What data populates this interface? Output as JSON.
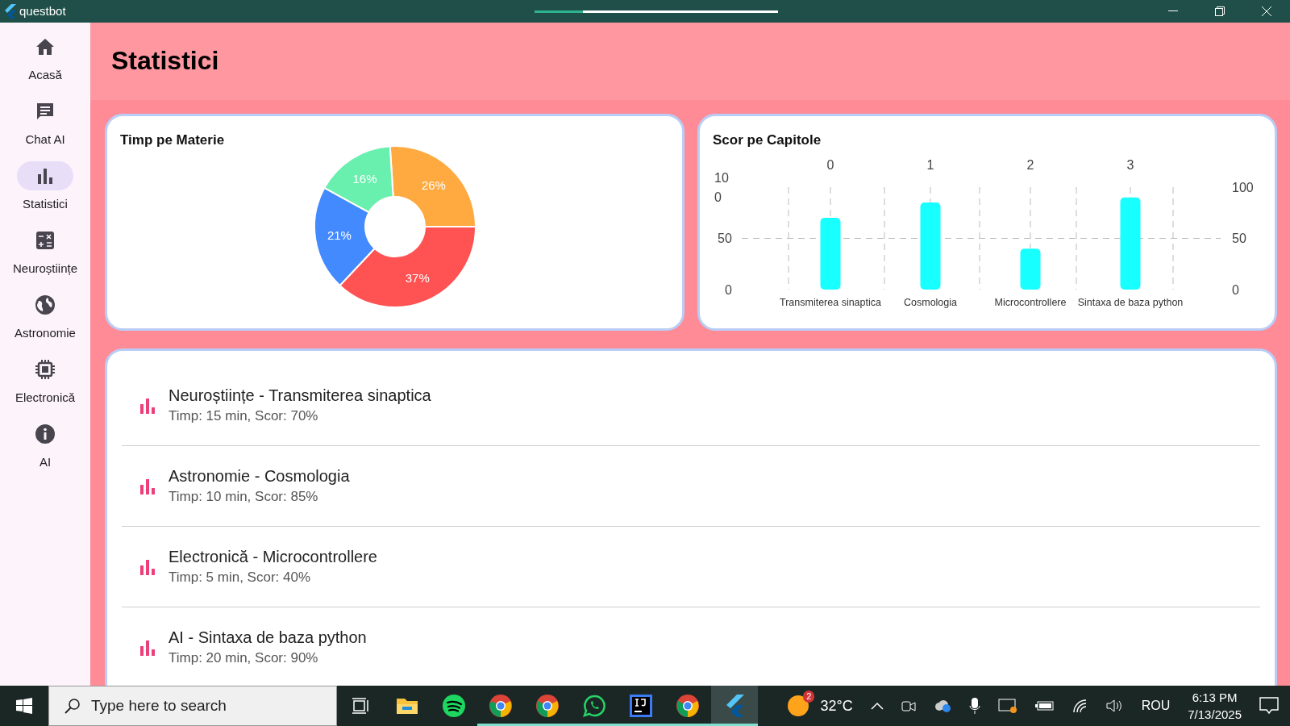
{
  "window": {
    "title": "questbot"
  },
  "sidebar": {
    "items": [
      {
        "label": "Acasă",
        "selected": false
      },
      {
        "label": "Chat AI",
        "selected": false
      },
      {
        "label": "Statistici",
        "selected": true
      },
      {
        "label": "Neuroștiințe",
        "selected": false
      },
      {
        "label": "Astronomie",
        "selected": false
      },
      {
        "label": "Electronică",
        "selected": false
      },
      {
        "label": "AI",
        "selected": false
      }
    ]
  },
  "page": {
    "title": "Statistici"
  },
  "time_chart": {
    "title": "Timp pe Materie",
    "chart_data": {
      "type": "donut",
      "values": [
        26,
        37,
        21,
        16
      ],
      "value_labels": [
        "26%",
        "37%",
        "21%",
        "16%"
      ],
      "data_labels": true
    }
  },
  "score_chart": {
    "title": "Scor pe Capitole",
    "top_axis_labels": [
      "0",
      "1",
      "2",
      "3"
    ],
    "right_axis_labels": [
      "100",
      "50",
      "0"
    ],
    "chart_data": {
      "type": "bar",
      "categories": [
        "Transmiterea sinaptica",
        "Cosmologia",
        "Microcontrollere",
        "Sintaxa de baza python"
      ],
      "values": [
        70,
        85,
        40,
        90
      ],
      "ylim": [
        0,
        100
      ],
      "yticks": [
        0,
        50,
        100
      ]
    }
  },
  "sessions": [
    {
      "title": "Neuroștiințe - Transmiterea sinaptica",
      "detail": "Timp: 15 min, Scor: 70%"
    },
    {
      "title": "Astronomie - Cosmologia",
      "detail": "Timp: 10 min, Scor: 85%"
    },
    {
      "title": "Electronică - Microcontrollere",
      "detail": "Timp: 5 min, Scor: 40%"
    },
    {
      "title": "AI - Sintaxa de baza python",
      "detail": "Timp: 20 min, Scor: 90%"
    }
  ],
  "taskbar": {
    "search": {
      "placeholder": "Type here to search"
    },
    "apps": [
      {
        "kind": "folder",
        "running": false,
        "active": false
      },
      {
        "kind": "spotify",
        "running": false,
        "active": false
      },
      {
        "kind": "chrome",
        "running": true,
        "active": false
      },
      {
        "kind": "chrome",
        "running": true,
        "active": false
      },
      {
        "kind": "whatsapp",
        "running": true,
        "active": false
      },
      {
        "kind": "ide",
        "running": true,
        "active": false
      },
      {
        "kind": "chrome",
        "running": true,
        "active": false
      },
      {
        "kind": "flutter",
        "running": true,
        "active": true
      }
    ],
    "weather": {
      "badge": "2",
      "temperature": "32°C"
    },
    "language": "ROU",
    "time": "6:13 PM",
    "date": "7/13/2025"
  }
}
